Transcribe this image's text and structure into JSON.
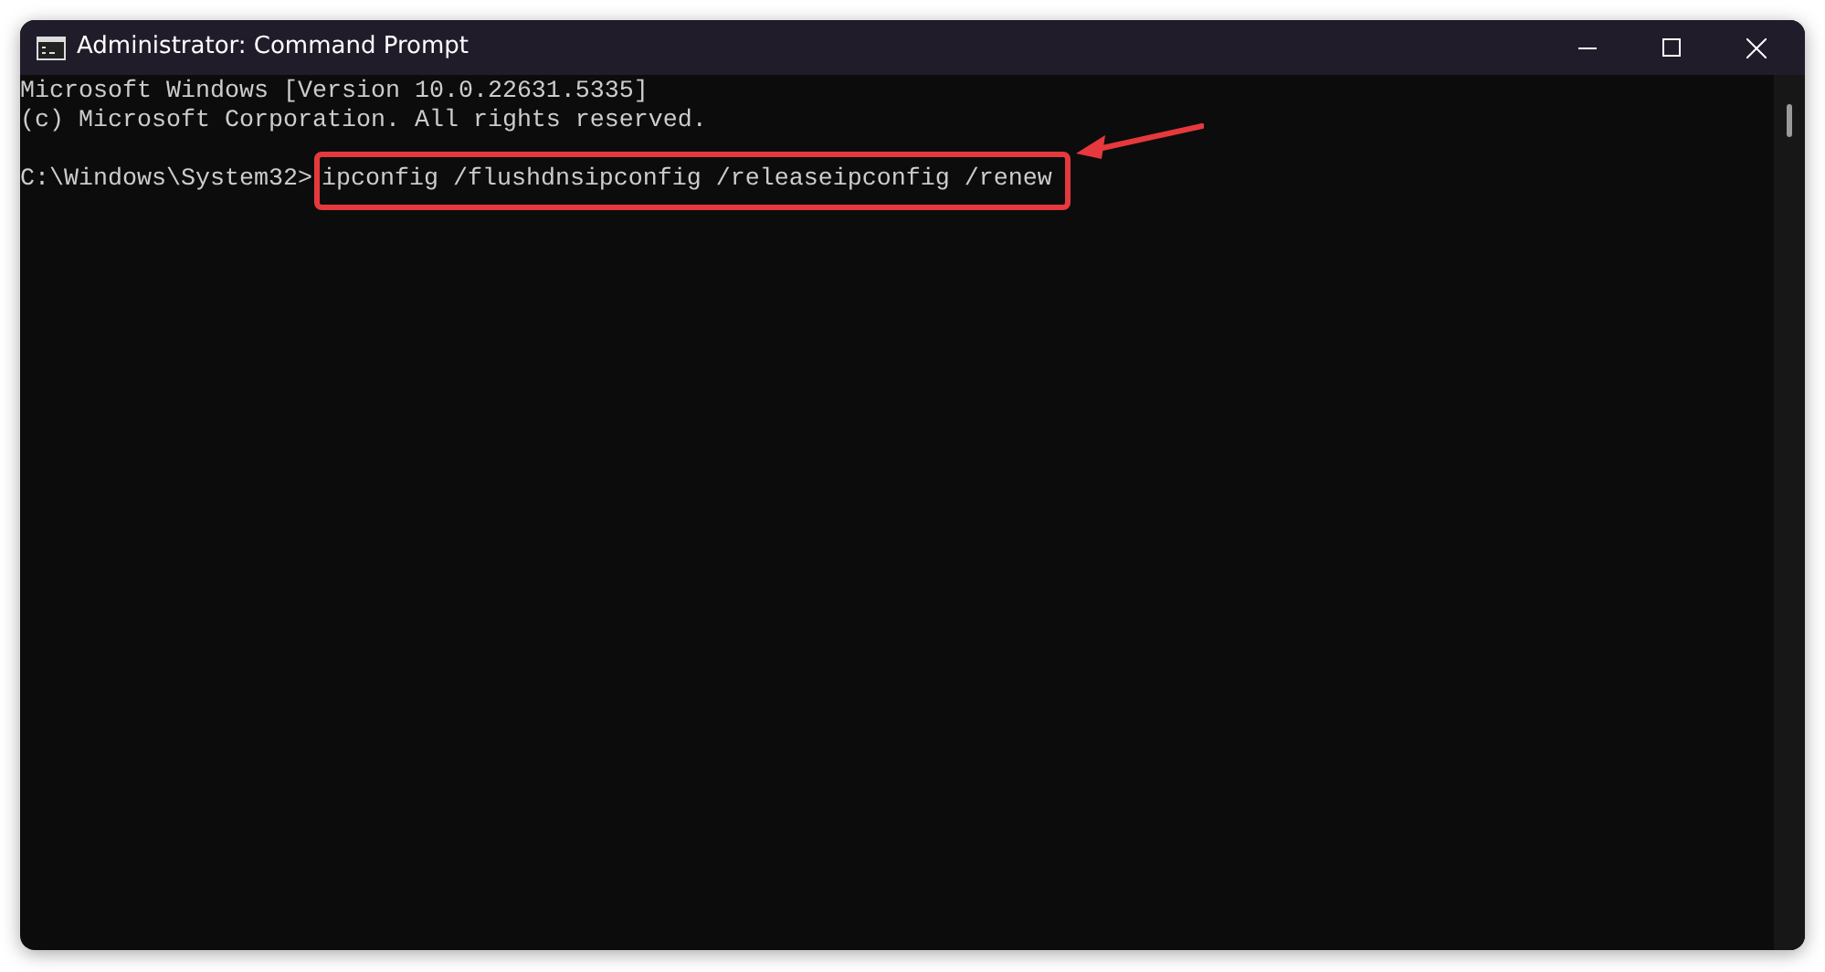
{
  "window": {
    "title": "Administrator: Command Prompt"
  },
  "output_lines": [
    "Microsoft Windows [Version 10.0.22631.5335]",
    "(c) Microsoft Corporation. All rights reserved."
  ],
  "prompt_line": {
    "prompt": "C:\\Windows\\System32>",
    "command": "ipconfig /flushdnsipconfig /releaseipconfig /renew",
    "highlighted": true
  }
}
